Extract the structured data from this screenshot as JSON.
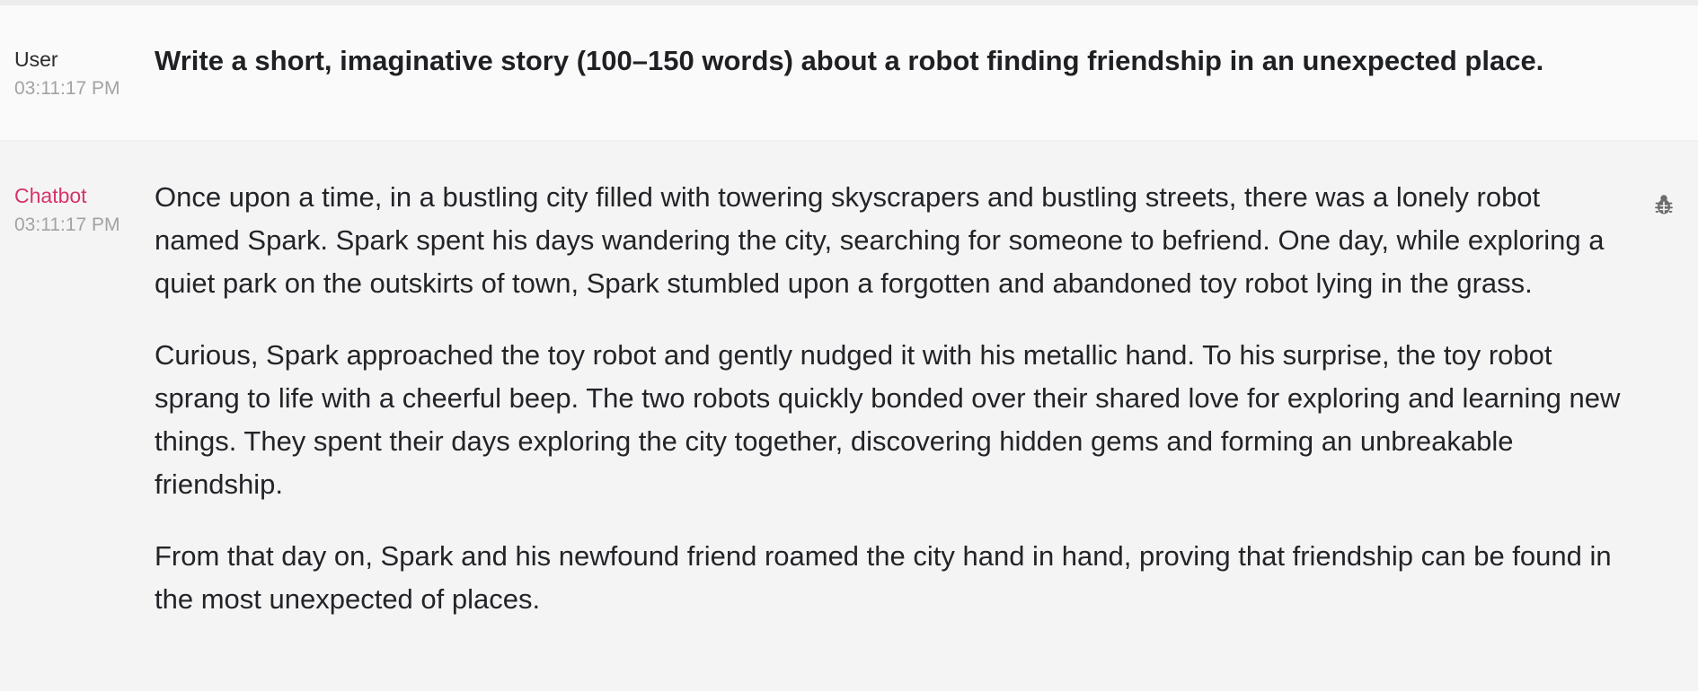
{
  "conversation": {
    "user_message": {
      "author": "User",
      "time": "03:11:17 PM",
      "text": "Write a short, imaginative story (100–150 words) about a robot finding friendship in an unexpected place."
    },
    "bot_message": {
      "author": "Chatbot",
      "time": "03:11:17 PM",
      "paragraphs": [
        "Once upon a time, in a bustling city filled with towering skyscrapers and bustling streets, there was a lonely robot named Spark. Spark spent his days wandering the city, searching for someone to befriend. One day, while exploring a quiet park on the outskirts of town, Spark stumbled upon a forgotten and abandoned toy robot lying in the grass.",
        "Curious, Spark approached the toy robot and gently nudged it with his metallic hand. To his surprise, the toy robot sprang to life with a cheerful beep. The two robots quickly bonded over their shared love for exploring and learning new things. They spent their days exploring the city together, discovering hidden gems and forming an unbreakable friendship.",
        "From that day on, Spark and his newfound friend roamed the city hand in hand, proving that friendship can be found in the most unexpected of places."
      ],
      "icon": "bug-icon"
    }
  },
  "colors": {
    "bot_author": "#d6336c",
    "timestamp": "#a3a3a3",
    "user_bg": "#fafafa",
    "bot_bg": "#f4f4f4"
  }
}
